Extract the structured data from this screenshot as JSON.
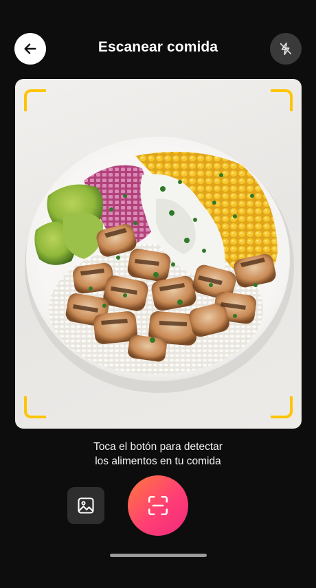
{
  "header": {
    "title": "Escanear comida",
    "back_icon": "arrow-left-icon",
    "flash_icon": "flash-off-icon"
  },
  "preview": {
    "frame_color": "#ffc400"
  },
  "instruction": {
    "line1": "Toca el botón para detectar",
    "line2": "los alimentos en tu comida"
  },
  "controls": {
    "gallery_icon": "image-icon",
    "scan_icon": "scan-icon",
    "scan_gradient": [
      "#ff7a3c",
      "#ff3f74",
      "#f0297d"
    ]
  }
}
